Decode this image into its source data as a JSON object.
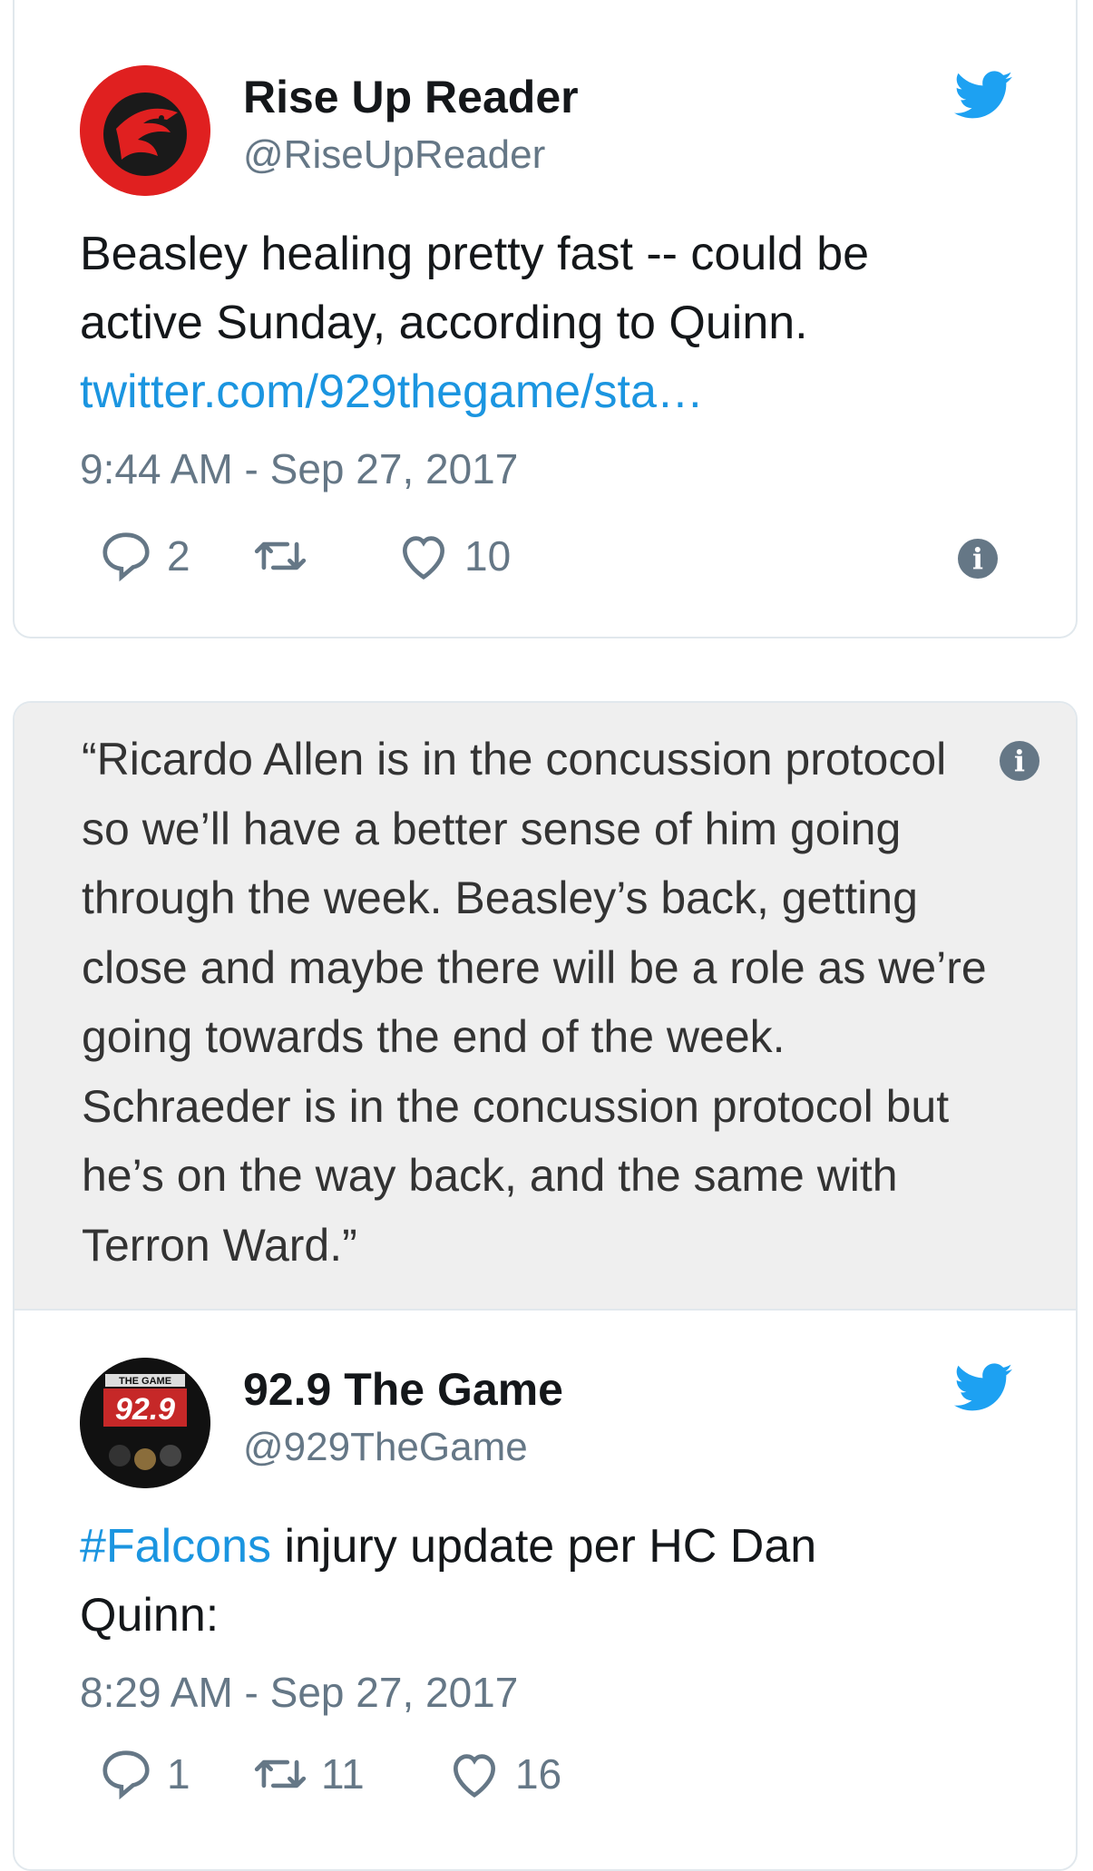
{
  "tweet1": {
    "name": "Rise Up Reader",
    "handle": "@RiseUpReader",
    "text": "Beasley healing pretty fast -- could be active Sunday, according to Quinn.",
    "link": "twitter.com/929thegame/sta…",
    "time": "9:44 AM - Sep 27, 2017",
    "replies": "2",
    "retweets": "",
    "likes": "10",
    "avatar_color": "#e02020"
  },
  "tweet2": {
    "quote": "“Ricardo Allen is in the concussion protocol so we’ll have a better sense of him going through the week. Beasley’s back, getting close and maybe there will be a role as we’re going towards the end of the week. Schraeder is in the concussion protocol but he’s on the way back, and the same with Terron Ward.”",
    "avatar_text": "92.9",
    "avatar_top": "THE GAME",
    "name": "92.9 The Game",
    "handle": "@929TheGame",
    "hashtag": "#Falcons",
    "text": " injury update per HC Dan Quinn:",
    "time": "8:29 AM - Sep 27, 2017",
    "replies": "1",
    "retweets": "11",
    "likes": "16"
  },
  "colors": {
    "link": "#1b95e0",
    "twitter_blue": "#1da1f2",
    "muted": "#657786"
  },
  "icons": [
    "twitter-bird-icon",
    "reply-icon",
    "retweet-icon",
    "like-icon",
    "info-icon"
  ]
}
